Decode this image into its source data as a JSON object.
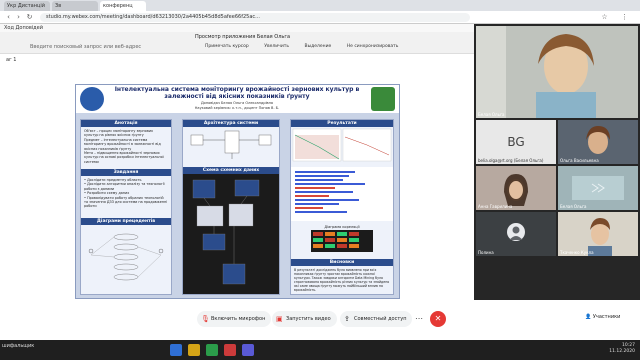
{
  "browser": {
    "tabs": [
      {
        "label": "Укр Дистанцій"
      },
      {
        "label": "Зв"
      },
      {
        "label": "конференц"
      }
    ],
    "url": "studio.my.webex.com/meeting/dashboard/d63213030/2a4405b45d8d5afee66f25ac...",
    "search_placeholder": "Введите поисковый запрос или веб-адрес"
  },
  "viewer": {
    "doc_label": "Ход Доповідей",
    "title": "Просмотр приложения Белая Ольга",
    "toolbar": [
      "Примечать курсор",
      "Увеличить",
      "Выделение",
      "Не синхронизировать"
    ],
    "page": "аг 1"
  },
  "poster": {
    "title": "Інтелектуальна система моніторингу врожайності зернових культур в залежності від якісних показників ґрунту",
    "authors": "Доповідач Белая Ольга Олександрівна\nНауковий керівник: к.т.н., доцент Попов В. Б.",
    "annotation": {
      "head": "Анотація",
      "text": "Об'єкт – процес моніторингу зернових культур на рівнях якісних ґрунту\nПредмет – інтелектуальна система моніторингу врожайності в залежності від якісних показників ґрунту\nМета – підвищення врожайності зернових культур на основі розробки інтелектуальної системи"
    },
    "tasks": {
      "head": "Завдання",
      "text": "• Дослідити предметну область\n• Дослідити алгоритми аналізу та технології роботи з даними\n• Розробити схему даних\n• Провалідувати роботу обраних технологій та значення ДЗЗ для системи на продовженні роботи"
    },
    "precedents_head": "Діаграми прецедентів",
    "architecture_head": "Архітектура системи",
    "schema_head": "Схема схемних даних",
    "results_head": "Результати",
    "results_sub1": "Діаграма кореляції",
    "results_sub2": "Діаграма кореляції",
    "conclusions": {
      "head": "Висновки",
      "text": "В результаті досліджень було виявлено при всіх показниках ґрунту зростає врожайність кожної культури. Також завдяки алгоритм Data Mining було спрогнозовано врожайність різних культур та знайдено які саме явища ґрунту можуть найбільший вплив на врожайність."
    }
  },
  "participants": [
    {
      "name": "Белая Ольга",
      "kind": "video"
    },
    {
      "name": "belia.olga@rt.org (Белая Ольга)",
      "initials": "BG",
      "kind": "initials"
    },
    {
      "name": "Ольга Васильевна",
      "kind": "video"
    },
    {
      "name": "Анна Гаврилина",
      "kind": "video"
    },
    {
      "name": "Белая Ольга",
      "kind": "video"
    },
    {
      "name": "Полина",
      "kind": "avatar"
    },
    {
      "name": "Ткаченко Кукла",
      "kind": "video"
    }
  ],
  "controls": {
    "mic": "Включить микрофон",
    "video": "Запустить видео",
    "share": "Совместный доступ",
    "participants": "Участники",
    "more": "⋯",
    "end": "✕"
  },
  "taskbar": {
    "left_label": "шифальщик",
    "time": "10:27",
    "date": "11.12.2020"
  },
  "colors": {
    "accent": "#2b4c8c",
    "end_call": "#e53935"
  }
}
